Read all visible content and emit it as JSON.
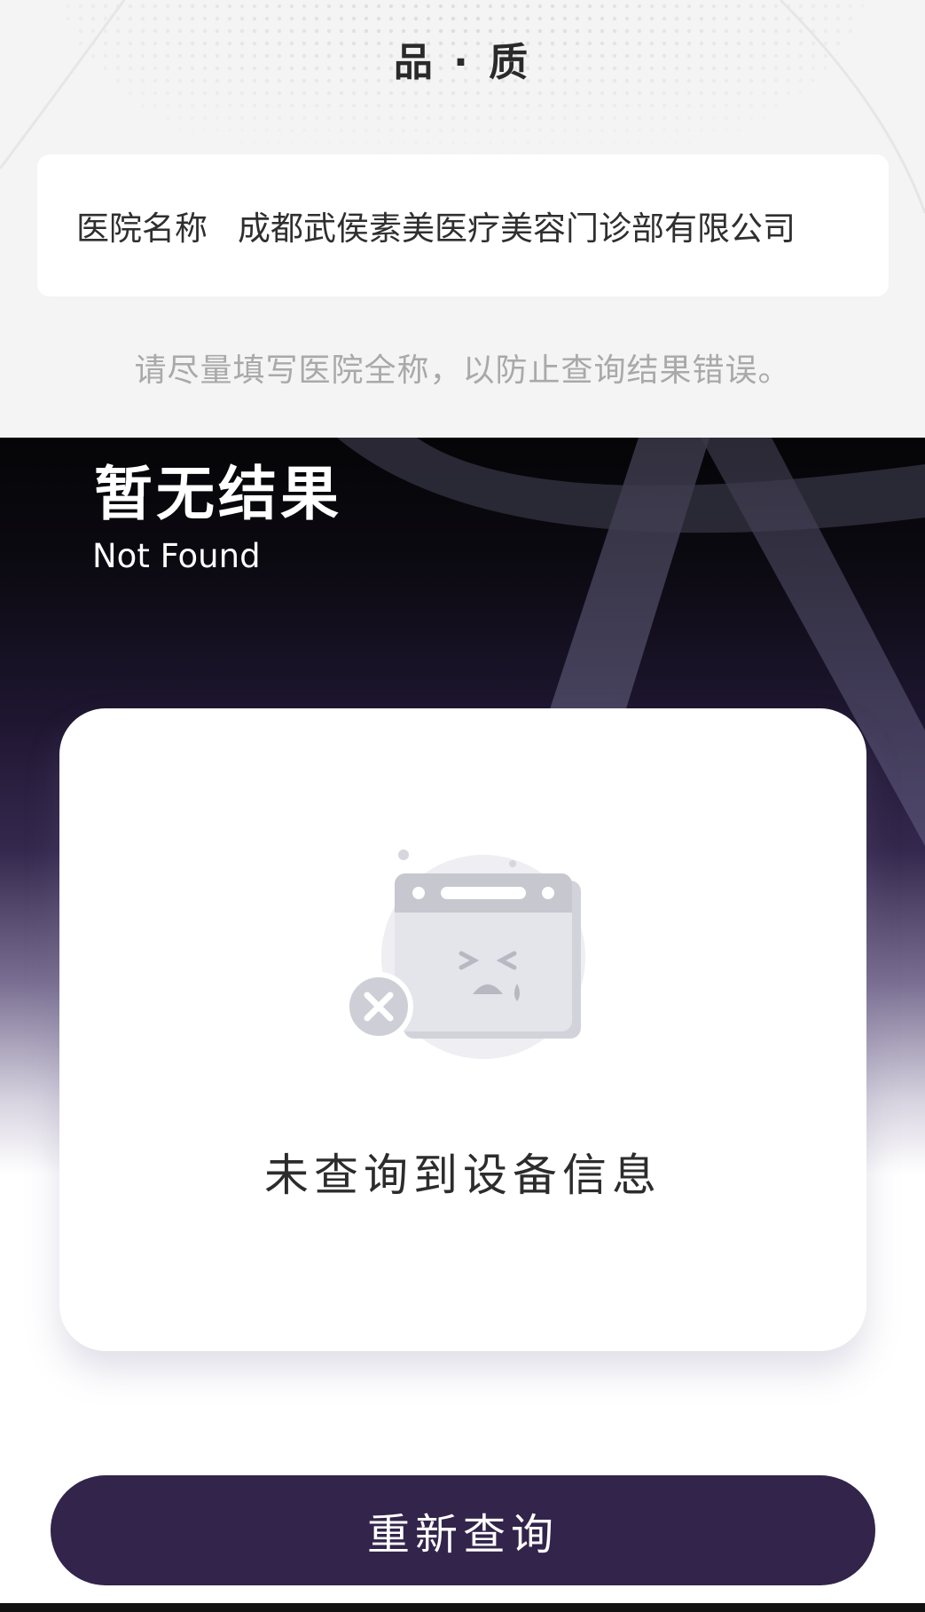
{
  "header": {
    "brand_title": "品 · 质"
  },
  "query_form": {
    "hospital_field": {
      "label": "医院名称",
      "value": "成都武侯素美医疗美容门诊部有限公司"
    },
    "hint": "请尽量填写医院全称，以防止查询结果错误。"
  },
  "result": {
    "title": "暂无结果",
    "subtitle": "Not Found",
    "empty_message": "未查询到设备信息",
    "empty_icon": "empty-browser-icon"
  },
  "actions": {
    "retry_label": "重新查询"
  },
  "colors": {
    "primary": "#33244b",
    "hint": "#a9a9a9",
    "top_background": "#f4f4f4"
  }
}
